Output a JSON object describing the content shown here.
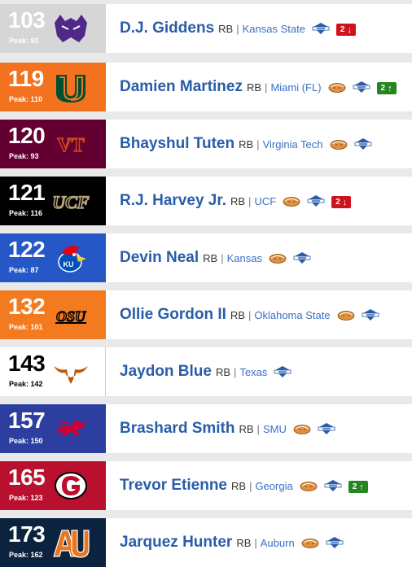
{
  "players": [
    {
      "rank": "103",
      "peak_label": "Peak: 91",
      "name": "D.J. Giddens",
      "position": "RB",
      "school": "Kansas State",
      "logo": "kansas-state-wildcat-logo",
      "badge_color": "#d6d6d6",
      "light": false,
      "icons": [
        "combine-icon"
      ],
      "trend": {
        "value": "2",
        "dir": "down"
      }
    },
    {
      "rank": "119",
      "peak_label": "Peak: 110",
      "name": "Damien Martinez",
      "position": "RB",
      "school": "Miami (FL)",
      "logo": "miami-u-logo",
      "badge_color": "#f2721f",
      "light": false,
      "icons": [
        "senior-bowl-icon",
        "combine-icon"
      ],
      "trend": {
        "value": "2",
        "dir": "up"
      }
    },
    {
      "rank": "120",
      "peak_label": "Peak: 93",
      "name": "Bhayshul Tuten",
      "position": "RB",
      "school": "Virginia Tech",
      "logo": "virginia-tech-vt-logo",
      "badge_color": "#630031",
      "light": false,
      "icons": [
        "senior-bowl-icon",
        "combine-icon"
      ],
      "trend": null
    },
    {
      "rank": "121",
      "peak_label": "Peak: 116",
      "name": "R.J. Harvey Jr.",
      "position": "RB",
      "school": "UCF",
      "logo": "ucf-logo",
      "badge_color": "#000000",
      "light": false,
      "icons": [
        "senior-bowl-icon",
        "combine-icon"
      ],
      "trend": {
        "value": "2",
        "dir": "down"
      }
    },
    {
      "rank": "122",
      "peak_label": "Peak: 87",
      "name": "Devin Neal",
      "position": "RB",
      "school": "Kansas",
      "logo": "kansas-jayhawk-logo",
      "badge_color": "#2557c6",
      "light": false,
      "icons": [
        "senior-bowl-icon",
        "combine-icon"
      ],
      "trend": null
    },
    {
      "rank": "132",
      "peak_label": "Peak: 101",
      "name": "Ollie Gordon II",
      "position": "RB",
      "school": "Oklahoma State",
      "logo": "oklahoma-state-osu-logo",
      "badge_color": "#f47a1f",
      "light": false,
      "icons": [
        "senior-bowl-icon",
        "combine-icon"
      ],
      "trend": null
    },
    {
      "rank": "143",
      "peak_label": "Peak: 142",
      "name": "Jaydon Blue",
      "position": "RB",
      "school": "Texas",
      "logo": "texas-longhorn-logo",
      "badge_color": "#ffffff",
      "light": true,
      "icons": [
        "combine-icon"
      ],
      "trend": null
    },
    {
      "rank": "157",
      "peak_label": "Peak: 150",
      "name": "Brashard Smith",
      "position": "RB",
      "school": "SMU",
      "logo": "smu-mustang-logo",
      "badge_color": "#2c3fa0",
      "light": false,
      "icons": [
        "senior-bowl-icon",
        "combine-icon"
      ],
      "trend": null
    },
    {
      "rank": "165",
      "peak_label": "Peak: 123",
      "name": "Trevor Etienne",
      "position": "RB",
      "school": "Georgia",
      "logo": "georgia-g-logo",
      "badge_color": "#b8102e",
      "light": false,
      "icons": [
        "senior-bowl-icon",
        "combine-icon"
      ],
      "trend": {
        "value": "2",
        "dir": "up"
      }
    },
    {
      "rank": "173",
      "peak_label": "Peak: 162",
      "name": "Jarquez Hunter",
      "position": "RB",
      "school": "Auburn",
      "logo": "auburn-au-logo",
      "badge_color": "#0c2340",
      "light": false,
      "icons": [
        "senior-bowl-icon",
        "combine-icon"
      ],
      "trend": null
    }
  ],
  "separator": "|",
  "colors": {
    "name": "#2a5da8",
    "school": "#3b6fc4",
    "trend_up": "#23861f",
    "trend_down": "#d0121c"
  }
}
